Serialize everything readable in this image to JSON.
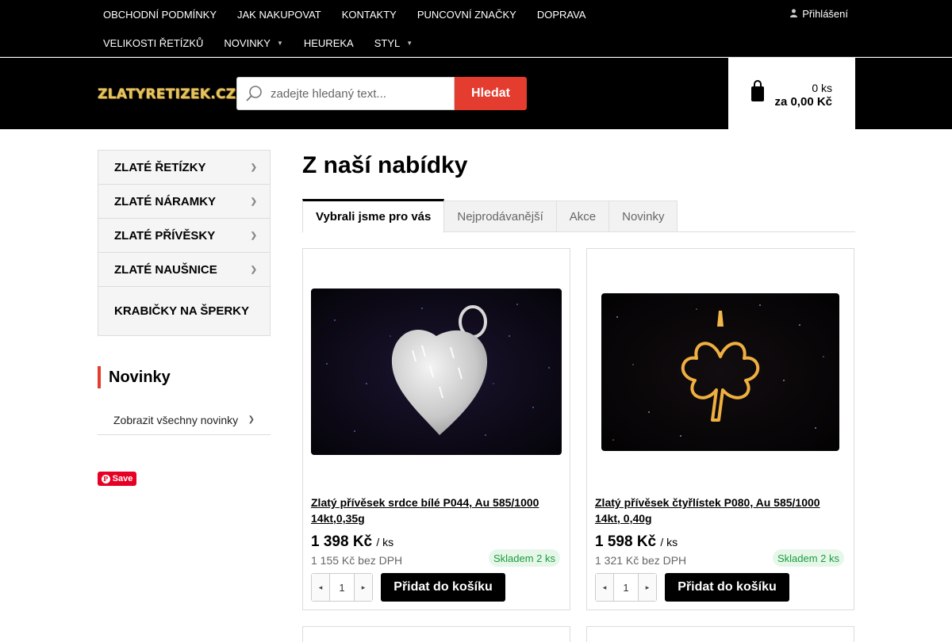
{
  "topnav": {
    "row1": [
      "OBCHODNÍ PODMÍNKY",
      "JAK NAKUPOVAT",
      "KONTAKTY",
      "PUNCOVNÍ ZNAČKY",
      "DOPRAVA"
    ],
    "row2": [
      "VELIKOSTI ŘETÍZKŮ",
      "NOVINKY",
      "HEUREKA",
      "STYL"
    ],
    "login_label": "Přihlášení"
  },
  "header": {
    "logo_text": "ZLATYRETIZEK.CZ",
    "search_placeholder": "zadejte hledaný text...",
    "search_button": "Hledat",
    "cart_count": "0 ks",
    "cart_total": "za 0,00 Kč"
  },
  "sidebar": {
    "categories": [
      "ZLATÉ ŘETÍZKY",
      "ZLATÉ NÁRAMKY",
      "ZLATÉ PŘÍVĚSKY",
      "ZLATÉ NAUŠNICE",
      "KRABIČKY NA ŠPERKY"
    ],
    "news_title": "Novinky",
    "news_link": "Zobrazit všechny novinky",
    "pin_label": "Save"
  },
  "main": {
    "title": "Z naší nabídky",
    "tabs": [
      "Vybrali jsme pro vás",
      "Nejprodávanější",
      "Akce",
      "Novinky"
    ],
    "products": [
      {
        "name": "Zlatý přívěsek srdce bílé P044, Au 585/1000 14kt,0,35g",
        "price": "1 398 Kč",
        "unit": "/ ks",
        "price_net": "1 155 Kč bez DPH",
        "stock": "Skladem 2 ks",
        "qty": "1",
        "add_label": "Přidat do košíku"
      },
      {
        "name": "Zlatý přívěsek čtyřlístek P080, Au 585/1000 14kt, 0,40g",
        "price": "1 598 Kč",
        "unit": "/ ks",
        "price_net": "1 321 Kč bez DPH",
        "stock": "Skladem 2 ks",
        "qty": "1",
        "add_label": "Přidat do košíku"
      }
    ]
  },
  "colors": {
    "accent_red": "#e43c2f",
    "header_bg": "#000000",
    "stock_green": "#1a9c3c",
    "logo_gold": "#e8c25a"
  },
  "icons": [
    "user-icon",
    "search-icon",
    "shopping-bag-icon",
    "chevron-right-icon",
    "chevron-down-icon",
    "arrow-left-icon",
    "arrow-right-icon",
    "pinterest-icon"
  ]
}
